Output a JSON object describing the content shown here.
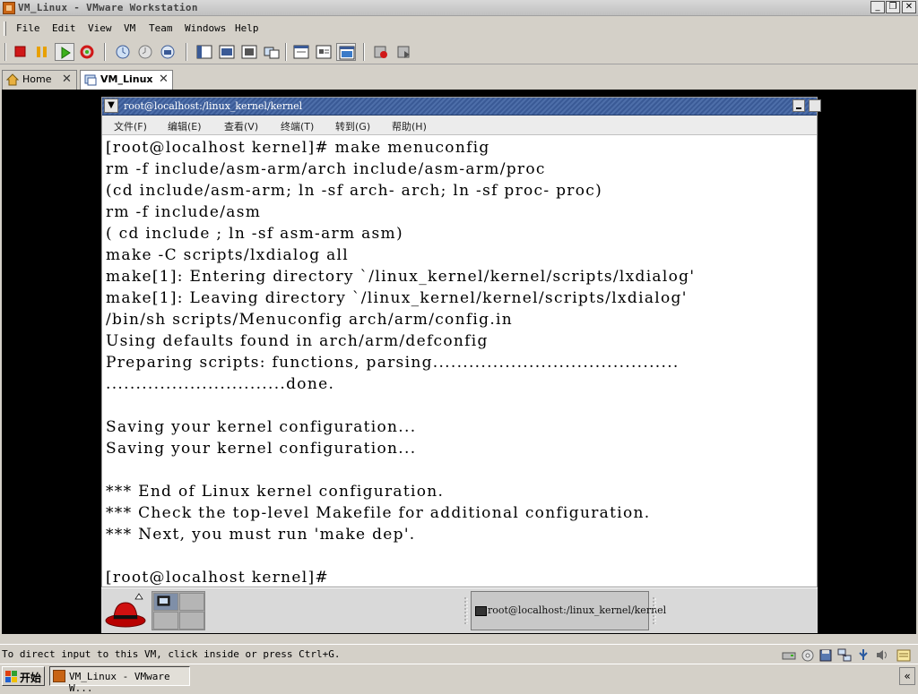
{
  "window": {
    "title": "VM_Linux - VMware Workstation"
  },
  "menubar": {
    "items": [
      {
        "label": "File"
      },
      {
        "label": "Edit"
      },
      {
        "label": "View"
      },
      {
        "label": "VM"
      },
      {
        "label": "Team"
      },
      {
        "label": "Windows"
      },
      {
        "label": "Help"
      }
    ]
  },
  "toolbar": {
    "buttons": [
      {
        "name": "power-off-icon"
      },
      {
        "name": "suspend-icon"
      },
      {
        "name": "power-on-icon"
      },
      {
        "name": "reset-icon"
      },
      {
        "name": "snapshot-icon"
      },
      {
        "name": "revert-snapshot-icon"
      },
      {
        "name": "snapshot-manager-icon"
      },
      {
        "name": "sidebar-icon"
      },
      {
        "name": "quick-switch-icon"
      },
      {
        "name": "full-screen-icon"
      },
      {
        "name": "unity-icon"
      },
      {
        "name": "summary-view-icon"
      },
      {
        "name": "appliance-view-icon"
      },
      {
        "name": "console-view-icon"
      },
      {
        "name": "record-icon"
      },
      {
        "name": "replay-icon"
      }
    ]
  },
  "tabs": [
    {
      "label": "Home"
    },
    {
      "label": "VM_Linux"
    }
  ],
  "guest": {
    "terminal": {
      "title": "root@localhost:/linux_kernel/kernel",
      "menu": [
        {
          "label": "文件(F)"
        },
        {
          "label": "编辑(E)"
        },
        {
          "label": "查看(V)"
        },
        {
          "label": "终端(T)"
        },
        {
          "label": "转到(G)"
        },
        {
          "label": "帮助(H)"
        }
      ],
      "lines": [
        "[root@localhost kernel]# make menuconfig",
        "rm -f include/asm-arm/arch include/asm-arm/proc",
        "(cd include/asm-arm; ln -sf arch- arch; ln -sf proc- proc)",
        "rm -f include/asm",
        "( cd include ; ln -sf asm-arm asm)",
        "make -C scripts/lxdialog all",
        "make[1]: Entering directory `/linux_kernel/kernel/scripts/lxdialog'",
        "make[1]: Leaving directory `/linux_kernel/kernel/scripts/lxdialog'",
        "/bin/sh scripts/Menuconfig arch/arm/config.in",
        "Using defaults found in arch/arm/defconfig",
        "Preparing scripts: functions, parsing.........................................",
        "..............................done.",
        "",
        "Saving your kernel configuration...",
        "Saving your kernel configuration...",
        "",
        "*** End of Linux kernel configuration.",
        "*** Check the top-level Makefile for additional configuration.",
        "*** Next, you must run 'make dep'.",
        "",
        "[root@localhost kernel]#"
      ]
    },
    "panel": {
      "task_label": "root@localhost:/linux_kernel/kernel"
    }
  },
  "statusbar": {
    "message": "To direct input to this VM, click inside or press Ctrl+G."
  },
  "taskbar": {
    "start_label": "开始",
    "item_label": "VM_Linux - VMware W..."
  }
}
